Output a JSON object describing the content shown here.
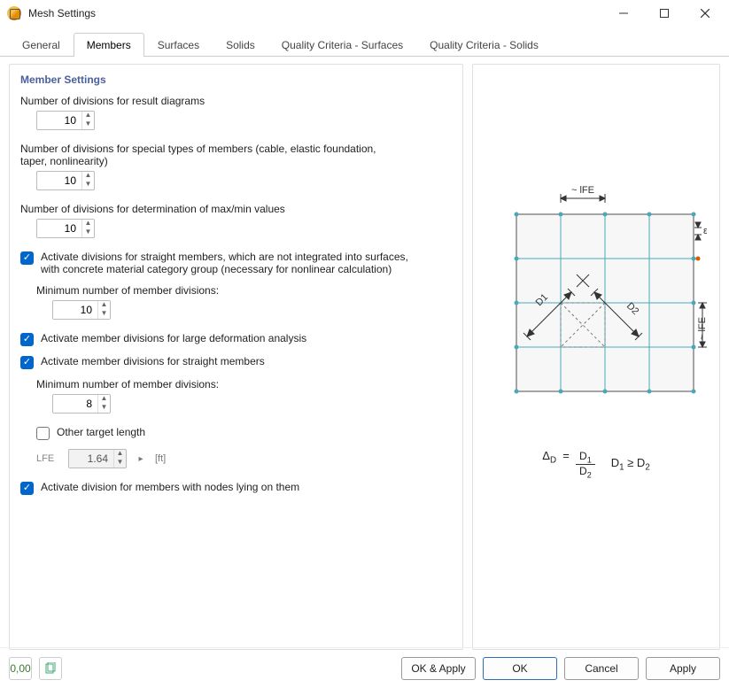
{
  "window": {
    "title": "Mesh Settings"
  },
  "tabs": [
    {
      "label": "General"
    },
    {
      "label": "Members"
    },
    {
      "label": "Surfaces"
    },
    {
      "label": "Solids"
    },
    {
      "label": "Quality Criteria - Surfaces"
    },
    {
      "label": "Quality Criteria - Solids"
    }
  ],
  "active_tab": "Members",
  "section": {
    "title": "Member Settings",
    "f1": {
      "label": "Number of divisions for result diagrams",
      "value": "10"
    },
    "f2": {
      "label": "Number of divisions for special types of members (cable, elastic foundation, taper, nonlinearity)",
      "value": "10"
    },
    "f3": {
      "label": "Number of divisions for determination of max/min values",
      "value": "10"
    },
    "c1": {
      "label": "Activate divisions for straight members, which are not integrated into surfaces, with concrete material category group (necessary for nonlinear calculation)",
      "sublabel": "Minimum number of member divisions:",
      "value": "10"
    },
    "c2": {
      "label": "Activate member divisions for large deformation analysis"
    },
    "c3": {
      "label": "Activate member divisions for straight members",
      "sublabel": "Minimum number of member divisions:",
      "value": "8",
      "otl_label": "Other target length",
      "otl_symbol": "LFE",
      "otl_value": "1.64",
      "otl_unit": "[ft]"
    },
    "c4": {
      "label": "Activate division for members with nodes lying on them"
    }
  },
  "diagram": {
    "top_label": "~ lFE",
    "right_label": "~ lFE",
    "eps": "ε",
    "d1": "D1",
    "d2": "D2",
    "delta_html": "ΔD",
    "eq": "=",
    "rel": "D1 ≥ D2"
  },
  "buttons": {
    "ok_apply": "OK & Apply",
    "ok": "OK",
    "cancel": "Cancel",
    "apply": "Apply"
  }
}
